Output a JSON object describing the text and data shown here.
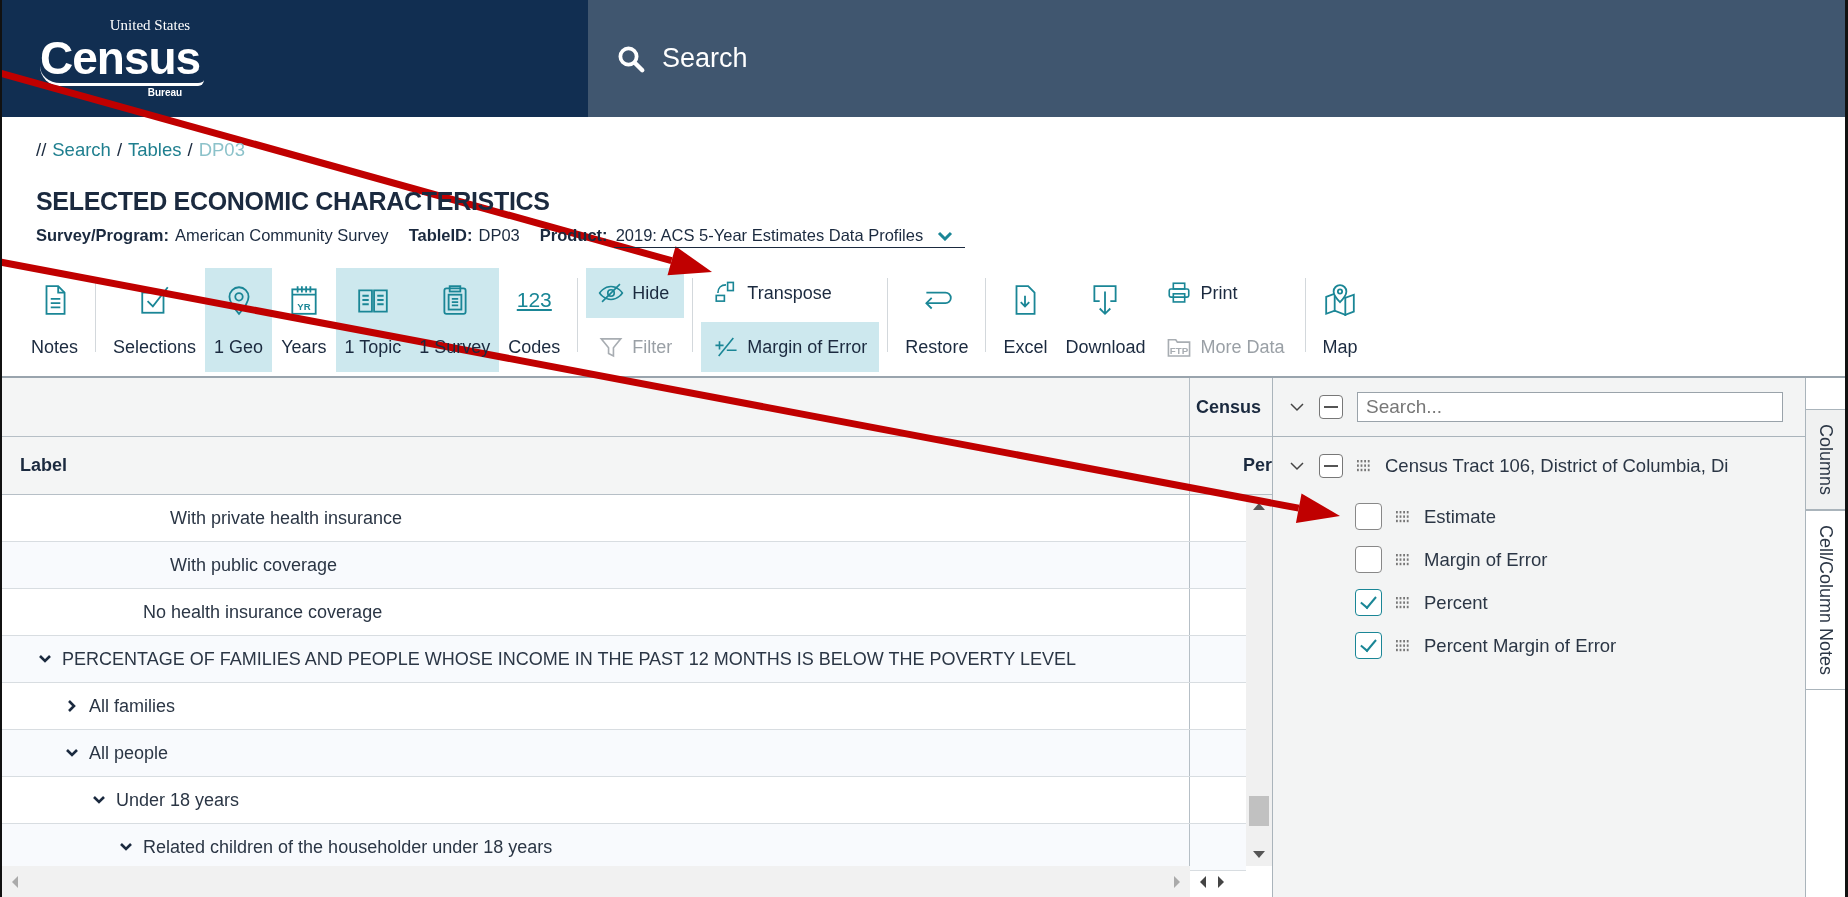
{
  "header": {
    "logo": {
      "top": "United States",
      "main": "Census",
      "bottom": "Bureau"
    },
    "search": {
      "placeholder": "Search"
    }
  },
  "breadcrumb": {
    "prefix": "//",
    "separator": "/",
    "items": [
      {
        "label": "Search",
        "current": false
      },
      {
        "label": "Tables",
        "current": false
      },
      {
        "label": "DP03",
        "current": true
      }
    ]
  },
  "title": "SELECTED ECONOMIC CHARACTERISTICS",
  "meta": [
    {
      "label": "Survey/Program:",
      "value": "American Community Survey"
    },
    {
      "label": "TableID:",
      "value": "DP03"
    }
  ],
  "product": {
    "label": "Product:",
    "value": "2019: ACS 5-Year Estimates Data Profiles"
  },
  "toolbar": [
    [
      {
        "kind": "large",
        "label": "Notes",
        "selected": false,
        "disabled": false
      }
    ],
    [
      {
        "kind": "large",
        "label": "Selections",
        "selected": false,
        "disabled": false
      },
      {
        "kind": "large",
        "label": "1 Geo",
        "selected": true,
        "disabled": false
      },
      {
        "kind": "large",
        "label": "Years",
        "glyph": "YR",
        "selected": false,
        "disabled": false
      },
      {
        "kind": "large",
        "label": "1 Topic",
        "selected": true,
        "disabled": false
      },
      {
        "kind": "large",
        "label": "1 Survey",
        "selected": true,
        "disabled": false
      },
      {
        "kind": "large",
        "label": "Codes",
        "glyph": "123",
        "selected": false,
        "disabled": false
      }
    ],
    [
      {
        "kind": "stack",
        "items": [
          {
            "label": "Hide",
            "selected": true,
            "disabled": false
          },
          {
            "label": "Filter",
            "selected": false,
            "disabled": true
          }
        ]
      }
    ],
    [
      {
        "kind": "stack",
        "items": [
          {
            "label": "Transpose",
            "selected": false,
            "disabled": false
          },
          {
            "label": "Margin of Error",
            "selected": true,
            "disabled": false
          }
        ]
      }
    ],
    [
      {
        "kind": "large",
        "label": "Restore",
        "selected": false,
        "disabled": false
      }
    ],
    [
      {
        "kind": "large",
        "label": "Excel",
        "selected": false,
        "disabled": false
      },
      {
        "kind": "large",
        "label": "Download",
        "selected": false,
        "disabled": false
      },
      {
        "kind": "stack",
        "items": [
          {
            "label": "Print",
            "selected": false,
            "disabled": false
          },
          {
            "label": "More Data",
            "glyph": "FTP",
            "selected": false,
            "disabled": true
          }
        ]
      }
    ],
    [
      {
        "kind": "large",
        "label": "Map",
        "selected": false,
        "disabled": false
      }
    ]
  ],
  "table": {
    "columns": [
      {
        "heading": "Label"
      },
      {
        "group": "Census",
        "heading": "Per"
      }
    ],
    "rows": [
      {
        "children": [
          {
            "children": [
              {
                "children": [
                  {
                    "children": [
                      {
                        "label": "With private health insurance"
                      },
                      {
                        "label": "With public coverage"
                      }
                    ]
                  },
                  {
                    "label": "No health insurance coverage"
                  }
                ]
              }
            ]
          }
        ]
      },
      {
        "label": "PERCENTAGE OF FAMILIES AND PEOPLE WHOSE INCOME IN THE PAST 12 MONTHS IS BELOW THE POVERTY LEVEL",
        "expanded": true,
        "children": [
          {
            "label": "All families",
            "expanded": false
          },
          {
            "label": "All people",
            "expanded": true,
            "children": [
              {
                "label": "Under 18 years",
                "expanded": true,
                "children": [
                  {
                    "label": "Related children of the householder under 18 years",
                    "expanded": true
                  }
                ]
              }
            ]
          }
        ]
      }
    ]
  },
  "column_panel": {
    "search": {
      "placeholder": "Search..."
    },
    "groups": [
      {
        "label": "Census Tract 106, District of Columbia, Di",
        "expanded": true,
        "items": [
          {
            "label": "Estimate",
            "checked": false
          },
          {
            "label": "Margin of Error",
            "checked": false
          },
          {
            "label": "Percent",
            "checked": true
          },
          {
            "label": "Percent Margin of Error",
            "checked": true
          }
        ]
      }
    ]
  },
  "side_tabs": [
    {
      "label": "Columns",
      "selected": true
    },
    {
      "label": "Cell/Column Notes",
      "selected": false
    }
  ]
}
